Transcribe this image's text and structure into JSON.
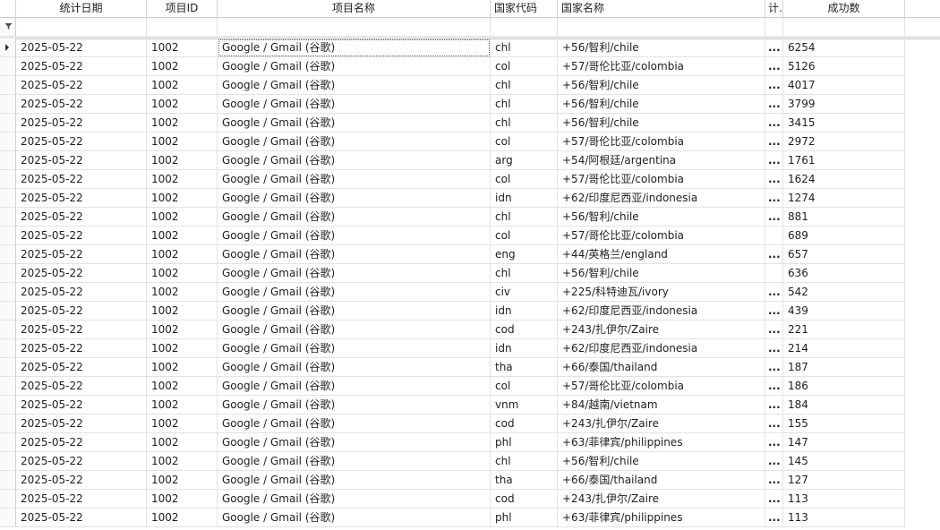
{
  "columns": [
    {
      "key": "date",
      "label": "统计日期"
    },
    {
      "key": "pid",
      "label": "项目ID"
    },
    {
      "key": "pname",
      "label": "项目名称"
    },
    {
      "key": "cc",
      "label": "国家代码"
    },
    {
      "key": "cn",
      "label": "国家名称"
    },
    {
      "key": "trunc",
      "label": "计…"
    },
    {
      "key": "succ",
      "label": "成功数"
    }
  ],
  "icons": {
    "filter_row": "filter-icon",
    "row_indicator": "current-row-arrow-icon"
  },
  "rows": [
    {
      "date": "2025-05-22",
      "pid": "1002",
      "pname": "Google / Gmail (谷歌)",
      "cc": "chl",
      "cn": "+56/智利/chile",
      "trunc": "...",
      "succ": "6254"
    },
    {
      "date": "2025-05-22",
      "pid": "1002",
      "pname": "Google / Gmail (谷歌)",
      "cc": "col",
      "cn": "+57/哥伦比亚/colombia",
      "trunc": "...",
      "succ": "5126"
    },
    {
      "date": "2025-05-22",
      "pid": "1002",
      "pname": "Google / Gmail (谷歌)",
      "cc": "chl",
      "cn": "+56/智利/chile",
      "trunc": "...",
      "succ": "4017"
    },
    {
      "date": "2025-05-22",
      "pid": "1002",
      "pname": "Google / Gmail (谷歌)",
      "cc": "chl",
      "cn": "+56/智利/chile",
      "trunc": "...",
      "succ": "3799"
    },
    {
      "date": "2025-05-22",
      "pid": "1002",
      "pname": "Google / Gmail (谷歌)",
      "cc": "chl",
      "cn": "+56/智利/chile",
      "trunc": "...",
      "succ": "3415"
    },
    {
      "date": "2025-05-22",
      "pid": "1002",
      "pname": "Google / Gmail (谷歌)",
      "cc": "col",
      "cn": "+57/哥伦比亚/colombia",
      "trunc": "...",
      "succ": "2972"
    },
    {
      "date": "2025-05-22",
      "pid": "1002",
      "pname": "Google / Gmail (谷歌)",
      "cc": "arg",
      "cn": "+54/阿根廷/argentina",
      "trunc": "...",
      "succ": "1761"
    },
    {
      "date": "2025-05-22",
      "pid": "1002",
      "pname": "Google / Gmail (谷歌)",
      "cc": "col",
      "cn": "+57/哥伦比亚/colombia",
      "trunc": "...",
      "succ": "1624"
    },
    {
      "date": "2025-05-22",
      "pid": "1002",
      "pname": "Google / Gmail (谷歌)",
      "cc": "idn",
      "cn": "+62/印度尼西亚/indonesia",
      "trunc": "...",
      "succ": "1274"
    },
    {
      "date": "2025-05-22",
      "pid": "1002",
      "pname": "Google / Gmail (谷歌)",
      "cc": "chl",
      "cn": "+56/智利/chile",
      "trunc": "...",
      "succ": "881"
    },
    {
      "date": "2025-05-22",
      "pid": "1002",
      "pname": "Google / Gmail (谷歌)",
      "cc": "col",
      "cn": "+57/哥伦比亚/colombia",
      "trunc": "",
      "succ": "689"
    },
    {
      "date": "2025-05-22",
      "pid": "1002",
      "pname": "Google / Gmail (谷歌)",
      "cc": "eng",
      "cn": "+44/英格兰/england",
      "trunc": "...",
      "succ": "657"
    },
    {
      "date": "2025-05-22",
      "pid": "1002",
      "pname": "Google / Gmail (谷歌)",
      "cc": "chl",
      "cn": "+56/智利/chile",
      "trunc": "",
      "succ": "636"
    },
    {
      "date": "2025-05-22",
      "pid": "1002",
      "pname": "Google / Gmail (谷歌)",
      "cc": "civ",
      "cn": "+225/科特迪瓦/ivory",
      "trunc": "...",
      "succ": "542"
    },
    {
      "date": "2025-05-22",
      "pid": "1002",
      "pname": "Google / Gmail (谷歌)",
      "cc": "idn",
      "cn": "+62/印度尼西亚/indonesia",
      "trunc": "...",
      "succ": "439"
    },
    {
      "date": "2025-05-22",
      "pid": "1002",
      "pname": "Google / Gmail (谷歌)",
      "cc": "cod",
      "cn": "+243/扎伊尔/Zaire",
      "trunc": "...",
      "succ": "221"
    },
    {
      "date": "2025-05-22",
      "pid": "1002",
      "pname": "Google / Gmail (谷歌)",
      "cc": "idn",
      "cn": "+62/印度尼西亚/indonesia",
      "trunc": "...",
      "succ": "214"
    },
    {
      "date": "2025-05-22",
      "pid": "1002",
      "pname": "Google / Gmail (谷歌)",
      "cc": "tha",
      "cn": "+66/泰国/thailand",
      "trunc": "...",
      "succ": "187"
    },
    {
      "date": "2025-05-22",
      "pid": "1002",
      "pname": "Google / Gmail (谷歌)",
      "cc": "col",
      "cn": "+57/哥伦比亚/colombia",
      "trunc": "...",
      "succ": "186"
    },
    {
      "date": "2025-05-22",
      "pid": "1002",
      "pname": "Google / Gmail (谷歌)",
      "cc": "vnm",
      "cn": "+84/越南/vietnam",
      "trunc": "...",
      "succ": "184"
    },
    {
      "date": "2025-05-22",
      "pid": "1002",
      "pname": "Google / Gmail (谷歌)",
      "cc": "cod",
      "cn": "+243/扎伊尔/Zaire",
      "trunc": "...",
      "succ": "155"
    },
    {
      "date": "2025-05-22",
      "pid": "1002",
      "pname": "Google / Gmail (谷歌)",
      "cc": "phl",
      "cn": "+63/菲律宾/philippines",
      "trunc": "...",
      "succ": "147"
    },
    {
      "date": "2025-05-22",
      "pid": "1002",
      "pname": "Google / Gmail (谷歌)",
      "cc": "chl",
      "cn": "+56/智利/chile",
      "trunc": "...",
      "succ": "145"
    },
    {
      "date": "2025-05-22",
      "pid": "1002",
      "pname": "Google / Gmail (谷歌)",
      "cc": "tha",
      "cn": "+66/泰国/thailand",
      "trunc": "...",
      "succ": "127"
    },
    {
      "date": "2025-05-22",
      "pid": "1002",
      "pname": "Google / Gmail (谷歌)",
      "cc": "cod",
      "cn": "+243/扎伊尔/Zaire",
      "trunc": "...",
      "succ": "113"
    },
    {
      "date": "2025-05-22",
      "pid": "1002",
      "pname": "Google / Gmail (谷歌)",
      "cc": "phl",
      "cn": "+63/菲律宾/philippines",
      "trunc": "...",
      "succ": "113"
    }
  ]
}
